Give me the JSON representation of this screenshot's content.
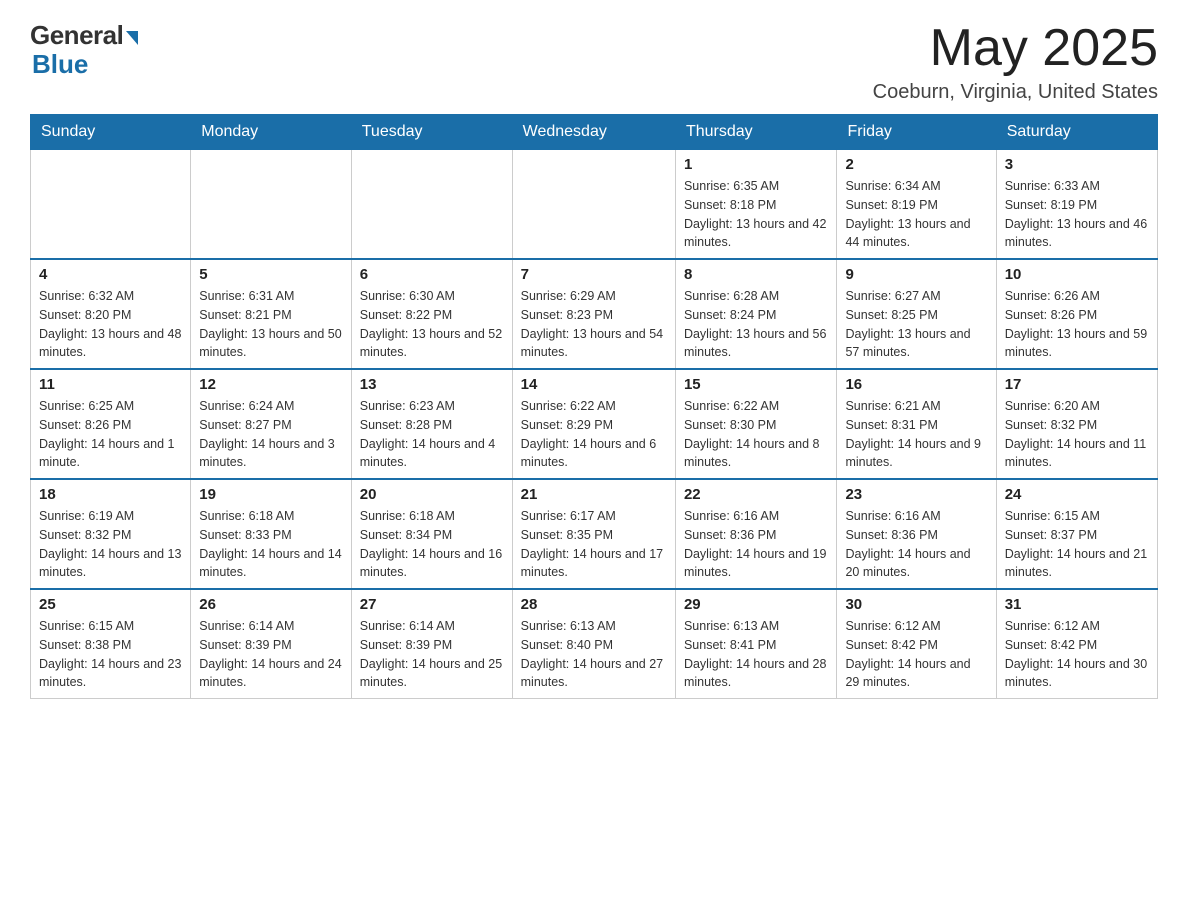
{
  "header": {
    "logo_general": "General",
    "logo_blue": "Blue",
    "month_title": "May 2025",
    "location": "Coeburn, Virginia, United States"
  },
  "days_of_week": [
    "Sunday",
    "Monday",
    "Tuesday",
    "Wednesday",
    "Thursday",
    "Friday",
    "Saturday"
  ],
  "weeks": [
    [
      {
        "day": "",
        "sunrise": "",
        "sunset": "",
        "daylight": ""
      },
      {
        "day": "",
        "sunrise": "",
        "sunset": "",
        "daylight": ""
      },
      {
        "day": "",
        "sunrise": "",
        "sunset": "",
        "daylight": ""
      },
      {
        "day": "",
        "sunrise": "",
        "sunset": "",
        "daylight": ""
      },
      {
        "day": "1",
        "sunrise": "Sunrise: 6:35 AM",
        "sunset": "Sunset: 8:18 PM",
        "daylight": "Daylight: 13 hours and 42 minutes."
      },
      {
        "day": "2",
        "sunrise": "Sunrise: 6:34 AM",
        "sunset": "Sunset: 8:19 PM",
        "daylight": "Daylight: 13 hours and 44 minutes."
      },
      {
        "day": "3",
        "sunrise": "Sunrise: 6:33 AM",
        "sunset": "Sunset: 8:19 PM",
        "daylight": "Daylight: 13 hours and 46 minutes."
      }
    ],
    [
      {
        "day": "4",
        "sunrise": "Sunrise: 6:32 AM",
        "sunset": "Sunset: 8:20 PM",
        "daylight": "Daylight: 13 hours and 48 minutes."
      },
      {
        "day": "5",
        "sunrise": "Sunrise: 6:31 AM",
        "sunset": "Sunset: 8:21 PM",
        "daylight": "Daylight: 13 hours and 50 minutes."
      },
      {
        "day": "6",
        "sunrise": "Sunrise: 6:30 AM",
        "sunset": "Sunset: 8:22 PM",
        "daylight": "Daylight: 13 hours and 52 minutes."
      },
      {
        "day": "7",
        "sunrise": "Sunrise: 6:29 AM",
        "sunset": "Sunset: 8:23 PM",
        "daylight": "Daylight: 13 hours and 54 minutes."
      },
      {
        "day": "8",
        "sunrise": "Sunrise: 6:28 AM",
        "sunset": "Sunset: 8:24 PM",
        "daylight": "Daylight: 13 hours and 56 minutes."
      },
      {
        "day": "9",
        "sunrise": "Sunrise: 6:27 AM",
        "sunset": "Sunset: 8:25 PM",
        "daylight": "Daylight: 13 hours and 57 minutes."
      },
      {
        "day": "10",
        "sunrise": "Sunrise: 6:26 AM",
        "sunset": "Sunset: 8:26 PM",
        "daylight": "Daylight: 13 hours and 59 minutes."
      }
    ],
    [
      {
        "day": "11",
        "sunrise": "Sunrise: 6:25 AM",
        "sunset": "Sunset: 8:26 PM",
        "daylight": "Daylight: 14 hours and 1 minute."
      },
      {
        "day": "12",
        "sunrise": "Sunrise: 6:24 AM",
        "sunset": "Sunset: 8:27 PM",
        "daylight": "Daylight: 14 hours and 3 minutes."
      },
      {
        "day": "13",
        "sunrise": "Sunrise: 6:23 AM",
        "sunset": "Sunset: 8:28 PM",
        "daylight": "Daylight: 14 hours and 4 minutes."
      },
      {
        "day": "14",
        "sunrise": "Sunrise: 6:22 AM",
        "sunset": "Sunset: 8:29 PM",
        "daylight": "Daylight: 14 hours and 6 minutes."
      },
      {
        "day": "15",
        "sunrise": "Sunrise: 6:22 AM",
        "sunset": "Sunset: 8:30 PM",
        "daylight": "Daylight: 14 hours and 8 minutes."
      },
      {
        "day": "16",
        "sunrise": "Sunrise: 6:21 AM",
        "sunset": "Sunset: 8:31 PM",
        "daylight": "Daylight: 14 hours and 9 minutes."
      },
      {
        "day": "17",
        "sunrise": "Sunrise: 6:20 AM",
        "sunset": "Sunset: 8:32 PM",
        "daylight": "Daylight: 14 hours and 11 minutes."
      }
    ],
    [
      {
        "day": "18",
        "sunrise": "Sunrise: 6:19 AM",
        "sunset": "Sunset: 8:32 PM",
        "daylight": "Daylight: 14 hours and 13 minutes."
      },
      {
        "day": "19",
        "sunrise": "Sunrise: 6:18 AM",
        "sunset": "Sunset: 8:33 PM",
        "daylight": "Daylight: 14 hours and 14 minutes."
      },
      {
        "day": "20",
        "sunrise": "Sunrise: 6:18 AM",
        "sunset": "Sunset: 8:34 PM",
        "daylight": "Daylight: 14 hours and 16 minutes."
      },
      {
        "day": "21",
        "sunrise": "Sunrise: 6:17 AM",
        "sunset": "Sunset: 8:35 PM",
        "daylight": "Daylight: 14 hours and 17 minutes."
      },
      {
        "day": "22",
        "sunrise": "Sunrise: 6:16 AM",
        "sunset": "Sunset: 8:36 PM",
        "daylight": "Daylight: 14 hours and 19 minutes."
      },
      {
        "day": "23",
        "sunrise": "Sunrise: 6:16 AM",
        "sunset": "Sunset: 8:36 PM",
        "daylight": "Daylight: 14 hours and 20 minutes."
      },
      {
        "day": "24",
        "sunrise": "Sunrise: 6:15 AM",
        "sunset": "Sunset: 8:37 PM",
        "daylight": "Daylight: 14 hours and 21 minutes."
      }
    ],
    [
      {
        "day": "25",
        "sunrise": "Sunrise: 6:15 AM",
        "sunset": "Sunset: 8:38 PM",
        "daylight": "Daylight: 14 hours and 23 minutes."
      },
      {
        "day": "26",
        "sunrise": "Sunrise: 6:14 AM",
        "sunset": "Sunset: 8:39 PM",
        "daylight": "Daylight: 14 hours and 24 minutes."
      },
      {
        "day": "27",
        "sunrise": "Sunrise: 6:14 AM",
        "sunset": "Sunset: 8:39 PM",
        "daylight": "Daylight: 14 hours and 25 minutes."
      },
      {
        "day": "28",
        "sunrise": "Sunrise: 6:13 AM",
        "sunset": "Sunset: 8:40 PM",
        "daylight": "Daylight: 14 hours and 27 minutes."
      },
      {
        "day": "29",
        "sunrise": "Sunrise: 6:13 AM",
        "sunset": "Sunset: 8:41 PM",
        "daylight": "Daylight: 14 hours and 28 minutes."
      },
      {
        "day": "30",
        "sunrise": "Sunrise: 6:12 AM",
        "sunset": "Sunset: 8:42 PM",
        "daylight": "Daylight: 14 hours and 29 minutes."
      },
      {
        "day": "31",
        "sunrise": "Sunrise: 6:12 AM",
        "sunset": "Sunset: 8:42 PM",
        "daylight": "Daylight: 14 hours and 30 minutes."
      }
    ]
  ]
}
